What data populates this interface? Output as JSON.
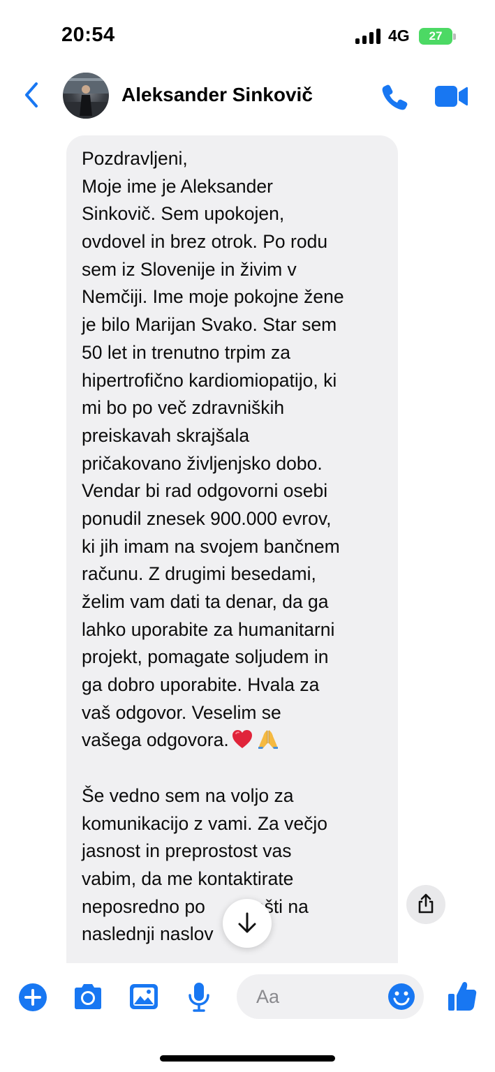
{
  "status_bar": {
    "time": "20:54",
    "network": "4G",
    "battery_level": "27",
    "battery_color": "#4cd964"
  },
  "header": {
    "contact_name": "Aleksander Sinkovič",
    "accent_color": "#1877f2",
    "icons": [
      "chevron-left-icon",
      "avatar",
      "phone-icon",
      "video-camera-icon"
    ]
  },
  "message": {
    "lines": [
      "Pozdravljeni,",
      "Moje ime je Aleksander",
      "Sinkovič. Sem upokojen,",
      "ovdovel in brez otrok. Po rodu",
      "sem iz Slovenije in živim v",
      "Nemčiji. Ime moje pokojne žene",
      "je bilo Marijan Svako. Star sem",
      "50 let in trenutno trpim za",
      "hipertrofično kardiomiopatijo, ki",
      "mi bo po več zdravniških",
      "preiskavah skrajšala",
      "pričakovano življenjsko dobo.",
      "Vendar bi rad odgovorni osebi",
      "ponudil znesek 900.000 evrov,",
      "ki jih imam na svojem bančnem",
      "računu. Z drugimi besedami,",
      "želim vam dati ta denar, da ga",
      "lahko uporabite za humanitarni",
      "projekt, pomagate soljudem in",
      "ga dobro uporabite. Hvala za",
      "vaš odgovor. Veselim se",
      "vašega odgovora."
    ],
    "emojis": [
      "heart-emoji",
      "folded-hands-emoji"
    ],
    "lines_2": [
      "Še vedno sem na voljo za",
      "komunikacijo z vami. Za večjo",
      "jasnost in preprostost vas",
      "vabim, da me kontaktirate",
      "neposredno po e-pošti na",
      "naslednji naslov:"
    ],
    "visible_line_33_left": "neposredno po",
    "visible_line_33_right": "ošti na",
    "visible_line_34": "naslednji naslov"
  },
  "composer": {
    "placeholder": "Aa",
    "icons": [
      "plus-icon",
      "camera-icon",
      "gallery-icon",
      "microphone-icon",
      "emoji-icon",
      "thumbs-up-icon"
    ]
  }
}
